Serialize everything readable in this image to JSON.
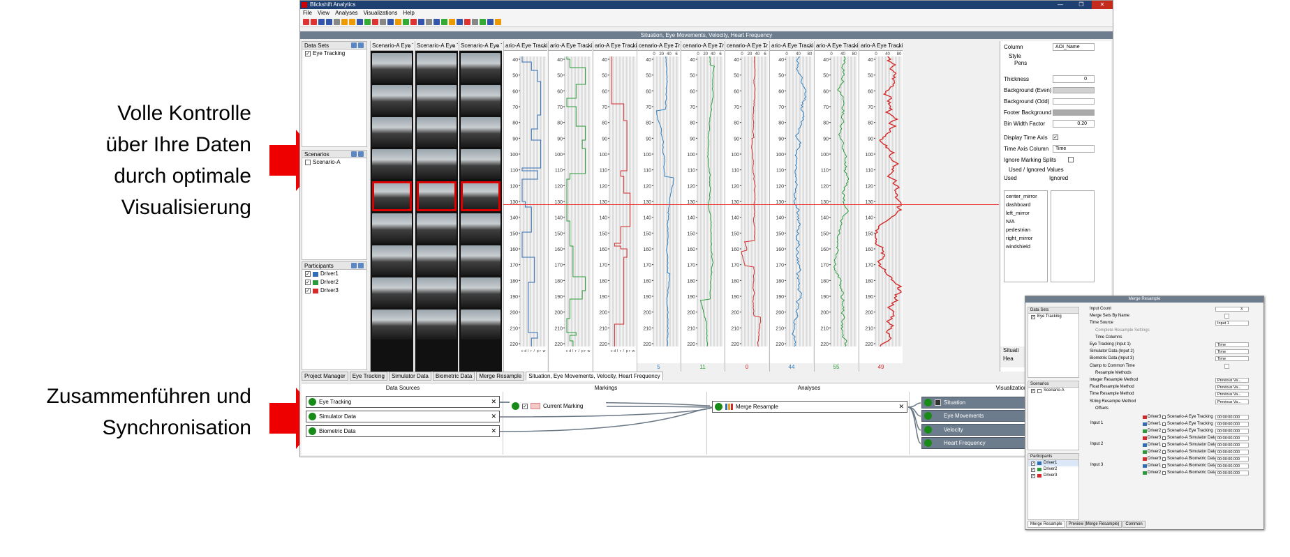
{
  "callouts": {
    "first": [
      "Volle Kontrolle",
      "über Ihre Daten",
      "durch optimale",
      "Visualisierung"
    ],
    "second": [
      "Zusammenführen und",
      "Synchronisation"
    ],
    "arrow_color": "#e00000"
  },
  "app": {
    "title": "Blickshift Analytics",
    "menu": [
      "File",
      "View",
      "Analyses",
      "Visualizations",
      "Help"
    ],
    "doc_title": "Situation, Eye Movements, Velocity, Heart Frequency",
    "panels": {
      "datasets": {
        "title": "Data Sets",
        "items": [
          {
            "label": "Eye Tracking",
            "checked": true
          }
        ]
      },
      "scenarios": {
        "title": "Scenarios",
        "items": [
          {
            "label": "Scenario-A",
            "checked": false
          }
        ]
      },
      "participants": {
        "title": "Participants",
        "items": [
          {
            "label": "Driver1",
            "checked": true,
            "color": "#2f6db5"
          },
          {
            "label": "Driver2",
            "checked": true,
            "color": "#2a9a3a"
          },
          {
            "label": "Driver3",
            "checked": true,
            "color": "#d22a2a"
          }
        ]
      }
    },
    "columns": [
      {
        "header": "Scenario-A Eye Tr",
        "type": "video"
      },
      {
        "header": "Scenario-A Eye Tr",
        "type": "video"
      },
      {
        "header": "Scenario-A Eye Tr",
        "type": "video"
      },
      {
        "header": "ario-A Eye Tracki",
        "type": "aoi",
        "color": "#2f6db5"
      },
      {
        "header": "ario-A Eye Tracki",
        "type": "aoi",
        "color": "#2a9a3a"
      },
      {
        "header": "ario-A Eye Tracki",
        "type": "aoi",
        "color": "#d22a2a"
      },
      {
        "header": "cenario-A Eye Tr",
        "type": "line",
        "color": "#2f7fc0",
        "footer": "5"
      },
      {
        "header": "cenario-A Eye Tr",
        "type": "line",
        "color": "#2a9a3a",
        "footer": "11"
      },
      {
        "header": "cenario-A Eye Tr",
        "type": "line",
        "color": "#d22a2a",
        "footer": "0"
      },
      {
        "header": "ario-A Eye Tracki",
        "type": "line",
        "color": "#2f7fc0",
        "footer": "44"
      },
      {
        "header": "ario-A Eye Tracki",
        "type": "line",
        "color": "#2a9a3a",
        "footer": "55"
      },
      {
        "header": "ario-A Eye Tracki",
        "type": "line",
        "color": "#d22a2a",
        "footer": "49"
      }
    ],
    "axis_ticks": [
      "40",
      "50",
      "60",
      "70",
      "80",
      "90",
      "100",
      "110",
      "120",
      "130",
      "140",
      "150",
      "160",
      "170",
      "180",
      "190",
      "200",
      "210",
      "220"
    ],
    "aoi_letters": [
      "c",
      "d",
      "l",
      "r",
      "/",
      "p",
      "r",
      "w"
    ],
    "top_scale": [
      "0",
      "20",
      "40",
      "6"
    ],
    "top_scale_wide": [
      "0",
      "40",
      "80"
    ],
    "properties": {
      "column_label": "Column",
      "column_value": "AOI_Name",
      "style": "Style",
      "pens": "Pens",
      "thickness_label": "Thickness",
      "thickness": "0",
      "bg_even": "Background (Even)",
      "bg_odd": "Background (Odd)",
      "footer_bg": "Footer Background",
      "bin_width_label": "Bin Width Factor",
      "bin_width": "0.20",
      "display_time_axis": "Display Time Axis",
      "time_axis_column": "Time Axis Column",
      "time_value": "Time",
      "ignore_marking": "Ignore Marking Splits",
      "used_ignored": "Used / Ignored Values",
      "used": "Used",
      "ignored": "Ignored",
      "used_values": [
        "center_mirror",
        "dashboard",
        "left_mirror",
        "N/A",
        "pedestrian",
        "right_mirror",
        "windshield"
      ],
      "cut_labels": [
        "Situati",
        "Hea"
      ]
    },
    "tabs": [
      "Project Manager",
      "Eye Tracking",
      "Simulator Data",
      "Biometric Data",
      "Merge Resample",
      "Situation, Eye Movements, Velocity, Heart Frequency"
    ],
    "flow": {
      "headers": [
        "Data Sources",
        "Markings",
        "Analyses",
        "Visualization"
      ],
      "sources": [
        "Eye Tracking",
        "Simulator Data",
        "Biometric Data"
      ],
      "marking": "Current Marking",
      "analysis": "Merge Resample",
      "visualizations": [
        "Situation",
        "Eye Movements",
        "Velocity",
        "Heart Frequency"
      ]
    }
  },
  "merge": {
    "title": "Merge Resample",
    "datasets": "Data Sets",
    "dataset_item": "Eye Tracking",
    "scenarios": "Scenarios",
    "scenario_item": "Scenario-A",
    "participants": "Participants",
    "drivers": [
      "Driver1",
      "Driver2",
      "Driver3"
    ],
    "rows": [
      {
        "label": "Input Count",
        "value": "3"
      },
      {
        "label": "Merge Sets By Name",
        "value": ""
      },
      {
        "label": "Time Source",
        "value": "Input 1"
      },
      {
        "label": "Complete Resample Settings",
        "value": ""
      },
      {
        "label": "Time Columns",
        "value": ""
      },
      {
        "label": "Eye Tracking (Input 1)",
        "value": "Time"
      },
      {
        "label": "Simulator Data (Input 2)",
        "value": "Time"
      },
      {
        "label": "Biometric Data (Input 3)",
        "value": "Time"
      },
      {
        "label": "Clamp to Common Time",
        "value": ""
      },
      {
        "label": "Resample Methods",
        "value": ""
      },
      {
        "label": "Integer Resample Method",
        "value": "Previous Va..."
      },
      {
        "label": "Float Resample Method",
        "value": "Previous Va..."
      },
      {
        "label": "Time Resample Method",
        "value": "Previous Va..."
      },
      {
        "label": "String Resample Method",
        "value": "Previous Va..."
      },
      {
        "label": "Offsets",
        "value": ""
      }
    ],
    "inputs": [
      {
        "label": "Input 1",
        "rows": [
          "Scenario-A Eye Tracking",
          "Scenario-A Eye Tracking",
          "Scenario-A Eye Tracking"
        ]
      },
      {
        "label": "Input 2",
        "rows": [
          "Scenario-A Simulator Data",
          "Scenario-A Simulator Data",
          "Scenario-A Simulator Data"
        ]
      },
      {
        "label": "Input 3",
        "rows": [
          "Scenario-A Biometric Data",
          "Scenario-A Biometric Data",
          "Scenario-A Biometric Data"
        ]
      }
    ],
    "offset_drivers": [
      "Driver3",
      "Driver1",
      "Driver2"
    ],
    "offset_value": "00:00:00.000",
    "tabs": [
      "Merge Resample",
      "Preview (Merge Resample)",
      "Common"
    ]
  }
}
